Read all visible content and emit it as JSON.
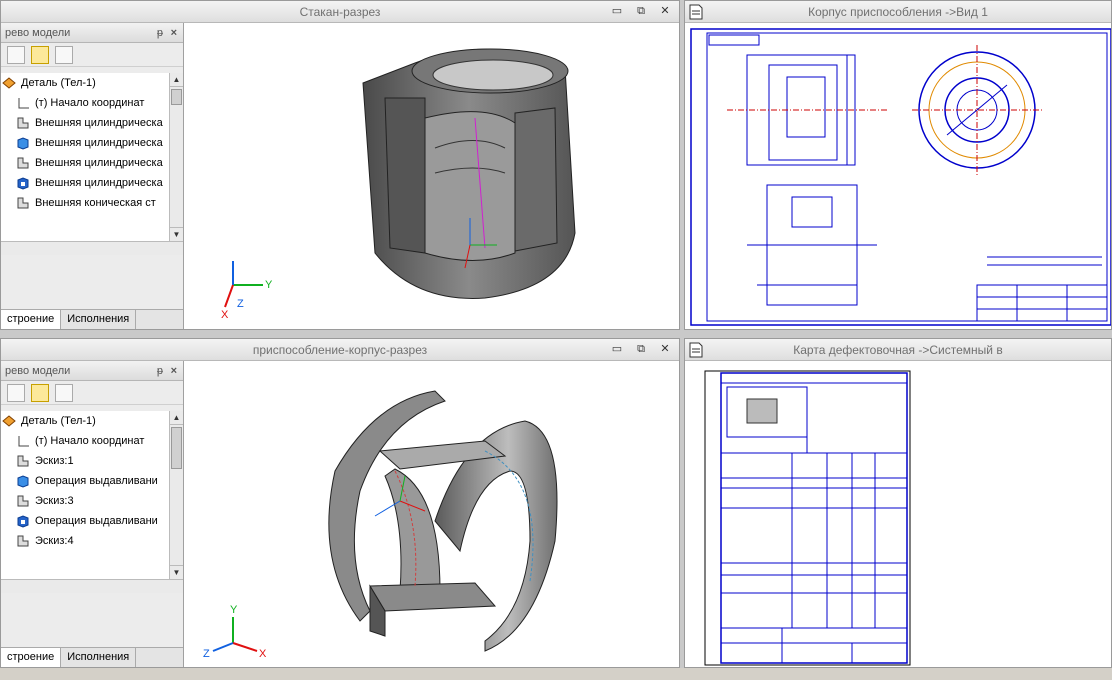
{
  "views": {
    "top_left_title": "Стакан-разрез",
    "bottom_left_title": "приспособление-корпус-разрез",
    "top_right_title": "Корпус приспособления ->Вид 1",
    "bottom_right_title": "Карта дефектовочная ->Системный в"
  },
  "window_buttons": {
    "minimize": "▭",
    "restore": "⧉",
    "close": "✕"
  },
  "tree_top": {
    "header": "рево модели",
    "pin": "ᵽ",
    "close": "×",
    "items": [
      {
        "label": "Деталь (Тел-1)"
      },
      {
        "label": "(т) Начало координат"
      },
      {
        "label": "Внешняя цилиндрическа"
      },
      {
        "label": "Внешняя цилиндрическа"
      },
      {
        "label": "Внешняя цилиндрическа"
      },
      {
        "label": "Внешняя цилиндрическа"
      },
      {
        "label": "Внешняя коническая ст"
      }
    ],
    "tabs": [
      "строение",
      "Исполнения"
    ]
  },
  "tree_bottom": {
    "header": "рево модели",
    "pin": "ᵽ",
    "close": "×",
    "items": [
      {
        "label": "Деталь (Тел-1)"
      },
      {
        "label": "(т) Начало координат"
      },
      {
        "label": "Эскиз:1"
      },
      {
        "label": "Операция выдавливани"
      },
      {
        "label": "Эскиз:3"
      },
      {
        "label": "Операция выдавливани"
      },
      {
        "label": "Эскиз:4"
      }
    ],
    "tabs": [
      "строение",
      "Исполнения"
    ]
  },
  "axes": {
    "x": "X",
    "y": "Y",
    "z": "Z"
  },
  "colors": {
    "axis_x": "#e01010",
    "axis_y": "#10b020",
    "axis_z": "#1060e0",
    "drawing_blue": "#0000cc",
    "model_gray": "#6b6b6b",
    "accent_orange": "#e08a00"
  }
}
